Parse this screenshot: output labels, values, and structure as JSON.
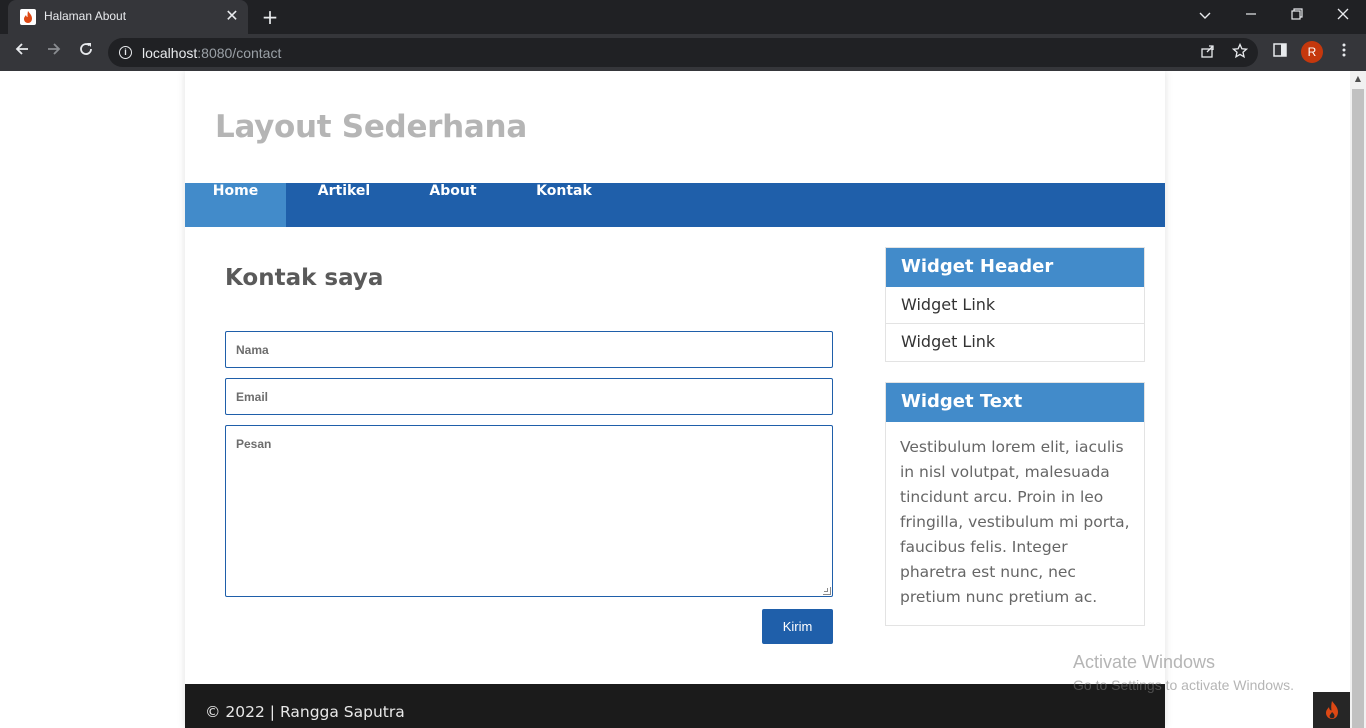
{
  "browser": {
    "tab_title": "Halaman About",
    "tab_close": "✕",
    "new_tab": "+",
    "url_host": "localhost",
    "url_rest": ":8080/contact",
    "profile_initial": "R",
    "icons": [
      "tab-favicon",
      "close-icon",
      "new-tab-icon",
      "chevron-down-icon",
      "minimize-icon",
      "restore-icon",
      "close-window-icon",
      "back-icon",
      "forward-icon",
      "reload-icon",
      "info-icon",
      "share-icon",
      "star-icon",
      "side-panel-icon",
      "more-icon"
    ]
  },
  "site": {
    "title": "Layout Sederhana",
    "nav": [
      {
        "label": "Home",
        "active": true
      },
      {
        "label": "Artikel",
        "active": false
      },
      {
        "label": "About",
        "active": false
      },
      {
        "label": "Kontak",
        "active": false
      }
    ]
  },
  "contact": {
    "heading": "Kontak saya",
    "name_placeholder": "Nama",
    "email_placeholder": "Email",
    "message_placeholder": "Pesan",
    "submit_label": "Kirim"
  },
  "sidebar": {
    "widget1": {
      "header": "Widget Header",
      "links": [
        "Widget Link",
        "Widget Link"
      ]
    },
    "widget2": {
      "header": "Widget Text",
      "body": "Vestibulum lorem elit, iaculis in nisl volutpat, malesuada tincidunt arcu. Proin in leo fringilla, vestibulum mi porta, faucibus felis. Integer pharetra est nunc, nec pretium nunc pretium ac."
    }
  },
  "footer": {
    "text": "© 2022 | Rangga Saputra"
  },
  "os_watermark": {
    "title": "Activate Windows",
    "subtitle": "Go to Settings to activate Windows."
  },
  "colors": {
    "nav_bg": "#1f5faa",
    "nav_active": "#428bca",
    "widget_header": "#428bca",
    "footer_bg": "#1b1b1b",
    "title_gray": "#b5b5b5"
  }
}
